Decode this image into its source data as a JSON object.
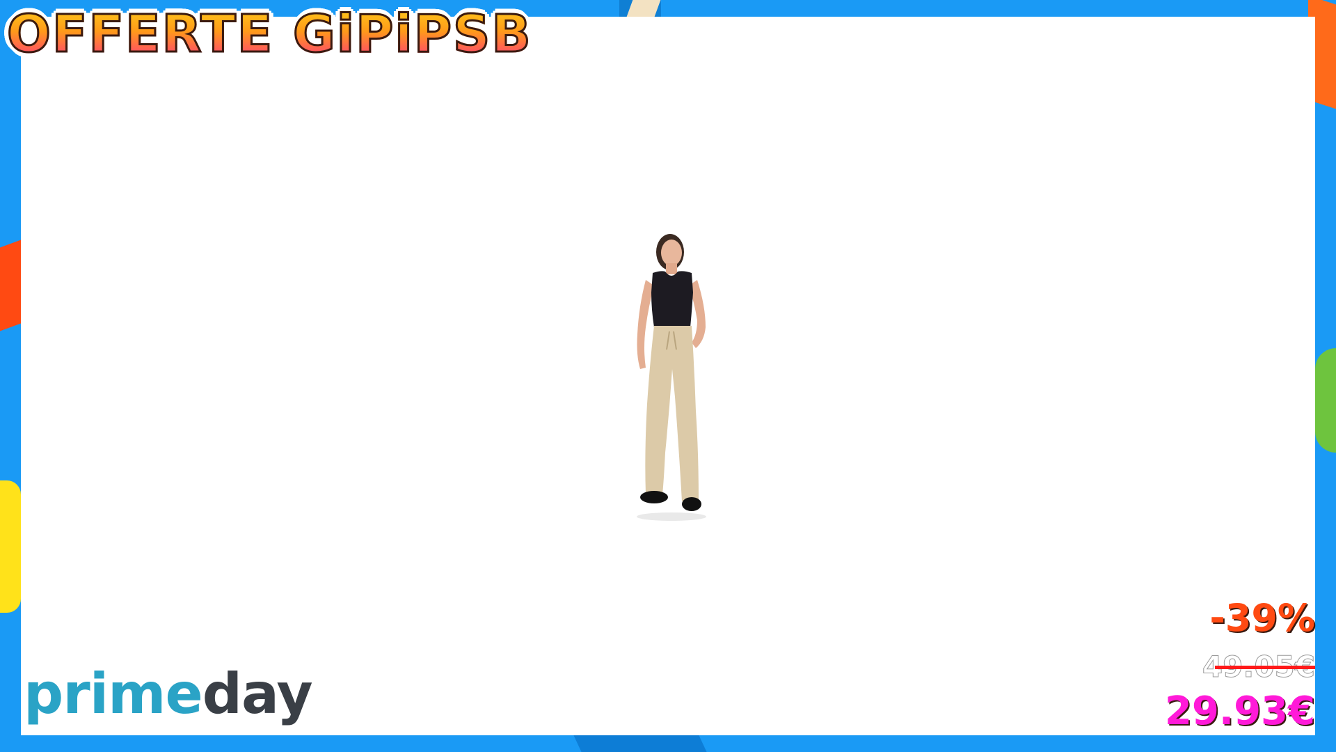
{
  "banner": {
    "brand_text": "OFFERTE GiPiPSB"
  },
  "product": {
    "image_icon": "woman-wearing-beige-wide-leg-trousers"
  },
  "promo": {
    "logo_prime": "prime",
    "logo_day": "day"
  },
  "pricing": {
    "discount": "-39%",
    "old_price": "49.05€",
    "new_price": "29.93€"
  },
  "colors": {
    "frame": "#1a9af5",
    "discount": "#ff4a12",
    "new_price": "#ff1ad8",
    "strike": "#ff1a1a",
    "prime_blue": "#2aa3c6"
  }
}
